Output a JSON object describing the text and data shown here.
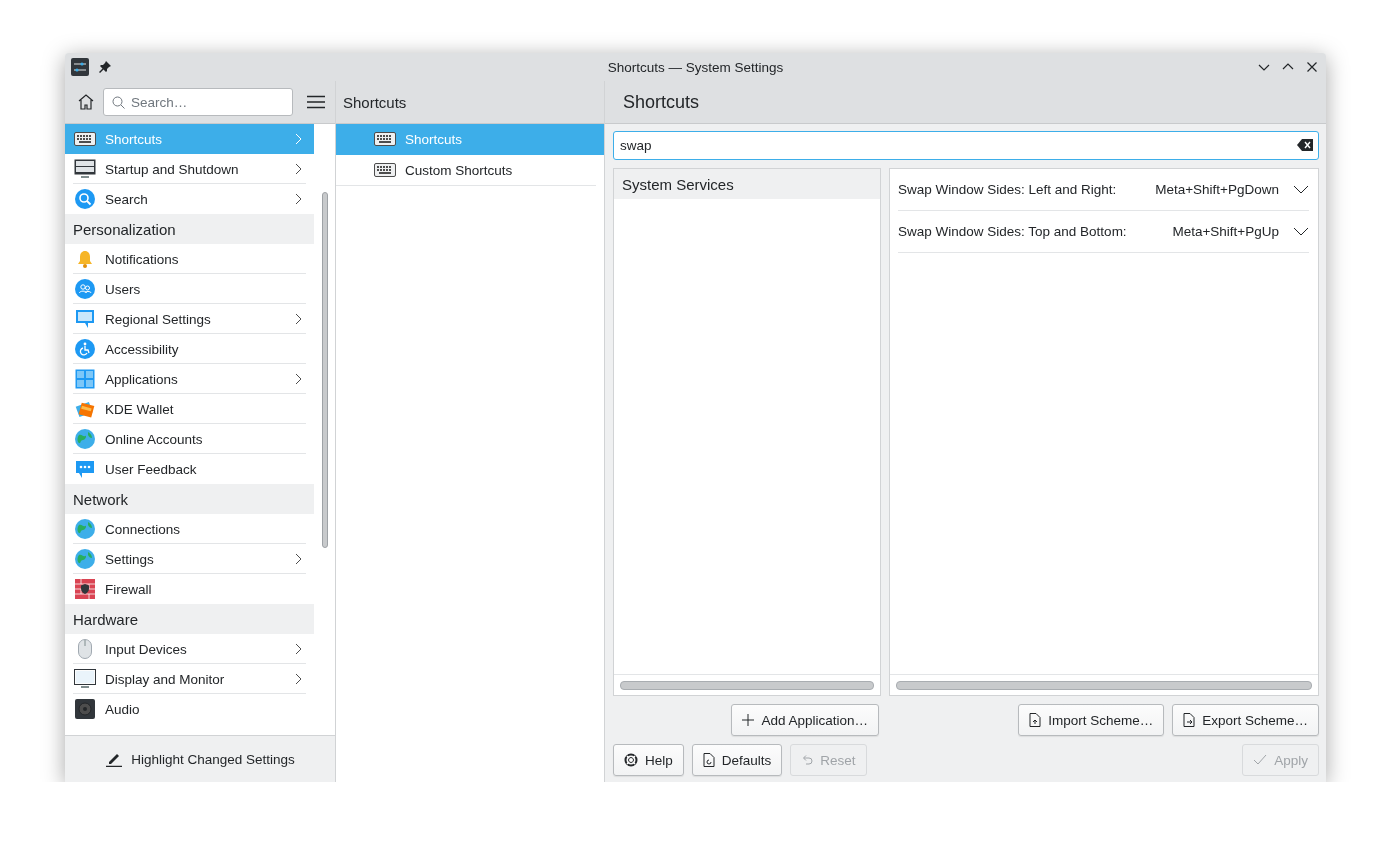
{
  "window": {
    "title": "Shortcuts — System Settings"
  },
  "sidebar": {
    "search": {
      "placeholder": "Search…"
    },
    "items": [
      {
        "kind": "item",
        "label": "Shortcuts",
        "selected": true,
        "has_children": true
      },
      {
        "kind": "item",
        "label": "Startup and Shutdown",
        "selected": false,
        "has_children": true
      },
      {
        "kind": "item",
        "label": "Search",
        "selected": false,
        "has_children": true
      },
      {
        "kind": "header",
        "label": "Personalization"
      },
      {
        "kind": "item",
        "label": "Notifications",
        "selected": false,
        "has_children": false
      },
      {
        "kind": "item",
        "label": "Users",
        "selected": false,
        "has_children": false
      },
      {
        "kind": "item",
        "label": "Regional Settings",
        "selected": false,
        "has_children": true
      },
      {
        "kind": "item",
        "label": "Accessibility",
        "selected": false,
        "has_children": false
      },
      {
        "kind": "item",
        "label": "Applications",
        "selected": false,
        "has_children": true
      },
      {
        "kind": "item",
        "label": "KDE Wallet",
        "selected": false,
        "has_children": false
      },
      {
        "kind": "item",
        "label": "Online Accounts",
        "selected": false,
        "has_children": false
      },
      {
        "kind": "item",
        "label": "User Feedback",
        "selected": false,
        "has_children": false
      },
      {
        "kind": "header",
        "label": "Network"
      },
      {
        "kind": "item",
        "label": "Connections",
        "selected": false,
        "has_children": false
      },
      {
        "kind": "item",
        "label": "Settings",
        "selected": false,
        "has_children": true
      },
      {
        "kind": "item",
        "label": "Firewall",
        "selected": false,
        "has_children": false
      },
      {
        "kind": "header",
        "label": "Hardware"
      },
      {
        "kind": "item",
        "label": "Input Devices",
        "selected": false,
        "has_children": true
      },
      {
        "kind": "item",
        "label": "Display and Monitor",
        "selected": false,
        "has_children": true
      },
      {
        "kind": "item",
        "label": "Audio",
        "selected": false,
        "has_children": false
      }
    ],
    "footer_button": "Highlight Changed Settings"
  },
  "middle": {
    "title": "Shortcuts",
    "items": [
      {
        "label": "Shortcuts",
        "selected": true
      },
      {
        "label": "Custom Shortcuts",
        "selected": false
      }
    ]
  },
  "content": {
    "title": "Shortcuts",
    "filter": {
      "value": "swap"
    },
    "applications": [
      {
        "label": "System Services",
        "selected": true
      }
    ],
    "shortcuts": [
      {
        "action": "Swap Window Sides: Left and Right:",
        "keys": "Meta+Shift+PgDown"
      },
      {
        "action": "Swap Window Sides: Top and Bottom:",
        "keys": "Meta+Shift+PgUp"
      }
    ],
    "add_button": {
      "label": "Add Application…",
      "disabled": false
    },
    "scheme_buttons": [
      {
        "kind": "import",
        "label": "Import Scheme…",
        "disabled": false
      },
      {
        "kind": "export",
        "label": "Export Scheme…",
        "disabled": false
      }
    ],
    "footer_buttons": [
      {
        "kind": "help",
        "label": "Help",
        "disabled": false
      },
      {
        "kind": "defaults",
        "label": "Defaults",
        "disabled": false
      },
      {
        "kind": "reset",
        "label": "Reset",
        "disabled": true
      },
      {
        "kind": "apply",
        "label": "Apply",
        "disabled": true
      }
    ]
  }
}
